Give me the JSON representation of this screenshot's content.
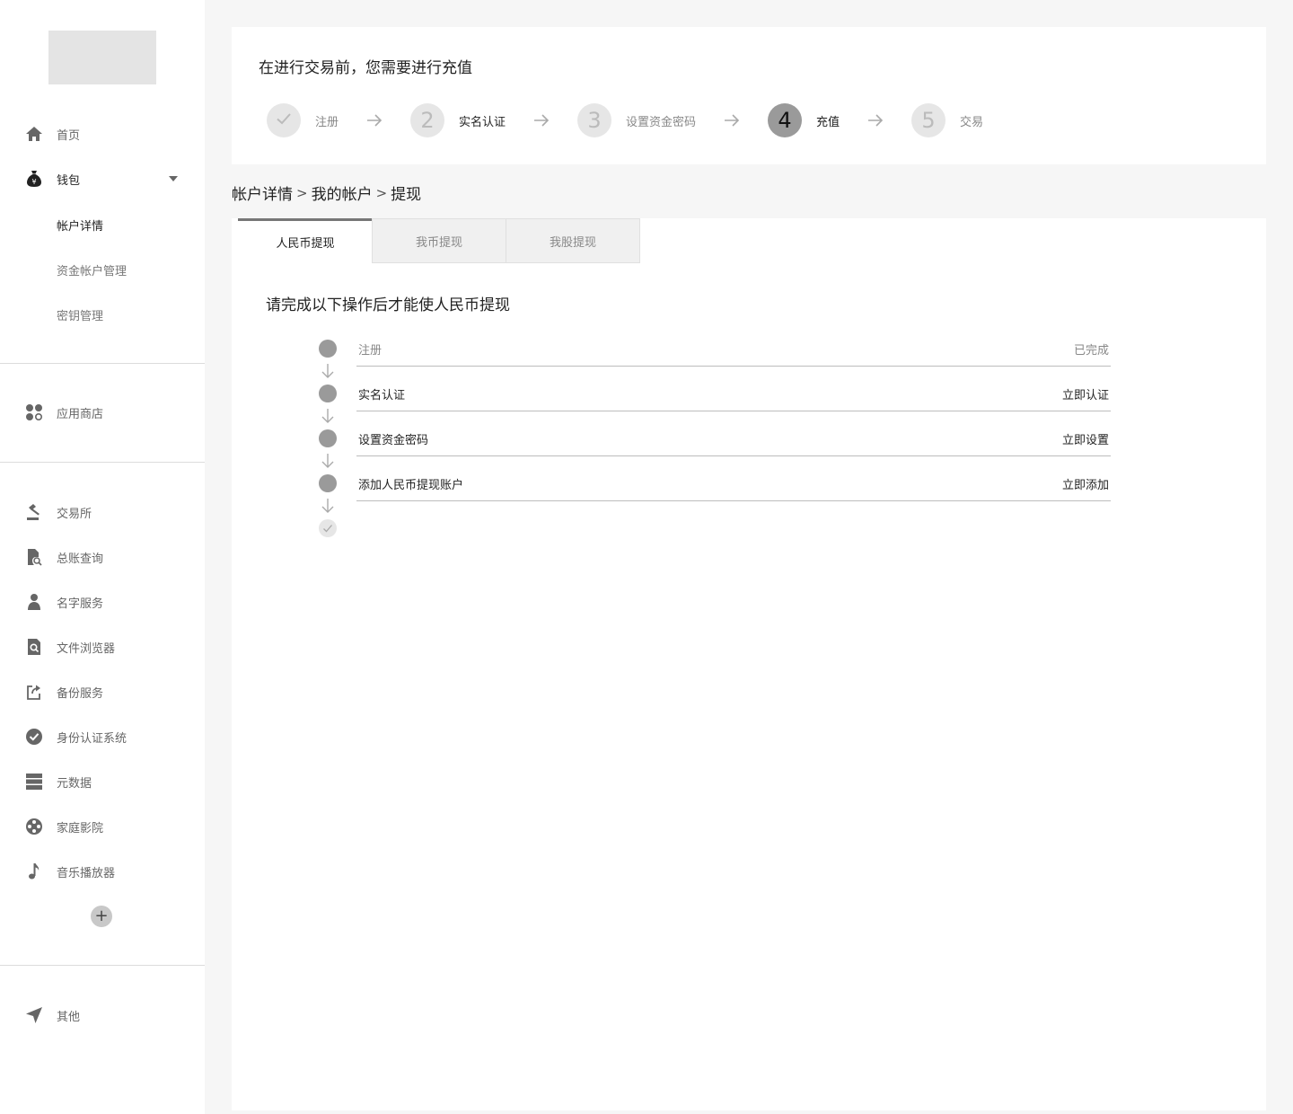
{
  "sidebar": {
    "home": "首页",
    "wallet": "钱包",
    "wallet_sub": [
      "帐户详情",
      "资金帐户管理",
      "密钥管理"
    ],
    "app_store": "应用商店",
    "apps": [
      "交易所",
      "总账查询",
      "名字服务",
      "文件浏览器",
      "备份服务",
      "身份认证系统",
      "元数据",
      "家庭影院",
      "音乐播放器"
    ],
    "add_label": "+",
    "other": "其他"
  },
  "steps": {
    "title": "在进行交易前，您需要进行充值",
    "items": [
      {
        "num": "",
        "label": "注册",
        "state": "done"
      },
      {
        "num": "2",
        "label": "实名认证",
        "state": "pending"
      },
      {
        "num": "3",
        "label": "设置资金密码",
        "state": "pending"
      },
      {
        "num": "4",
        "label": "充值",
        "state": "current"
      },
      {
        "num": "5",
        "label": "交易",
        "state": "pending"
      }
    ]
  },
  "breadcrumb": {
    "items": [
      "帐户详情",
      "我的帐户",
      "提现"
    ],
    "separator": ">"
  },
  "tabs": [
    "人民币提现",
    "我币提现",
    "我股提现"
  ],
  "main": {
    "notice": "请完成以下操作后才能使人民币提现",
    "requirements": [
      {
        "label": "注册",
        "action": "已完成"
      },
      {
        "label": "实名认证",
        "action": "立即认证"
      },
      {
        "label": "设置资金密码",
        "action": "立即设置"
      },
      {
        "label": "添加人民币提现账户",
        "action": "立即添加"
      }
    ]
  },
  "colors": {
    "accent": "#9a9a9a",
    "icon": "#666666",
    "background": "#f6f6f6"
  },
  "icons": {
    "home": "home-icon",
    "wallet": "money-bag-icon",
    "app_store": "apps-icon",
    "exchange": "gavel-icon",
    "ledger": "ledger-search-icon",
    "name_service": "person-icon",
    "file_browser": "file-search-icon",
    "backup": "share-upload-icon",
    "identity": "check-circle-icon",
    "metadata": "database-icon",
    "theater": "film-reel-icon",
    "music": "music-note-icon",
    "other": "navigation-arrow-icon"
  }
}
